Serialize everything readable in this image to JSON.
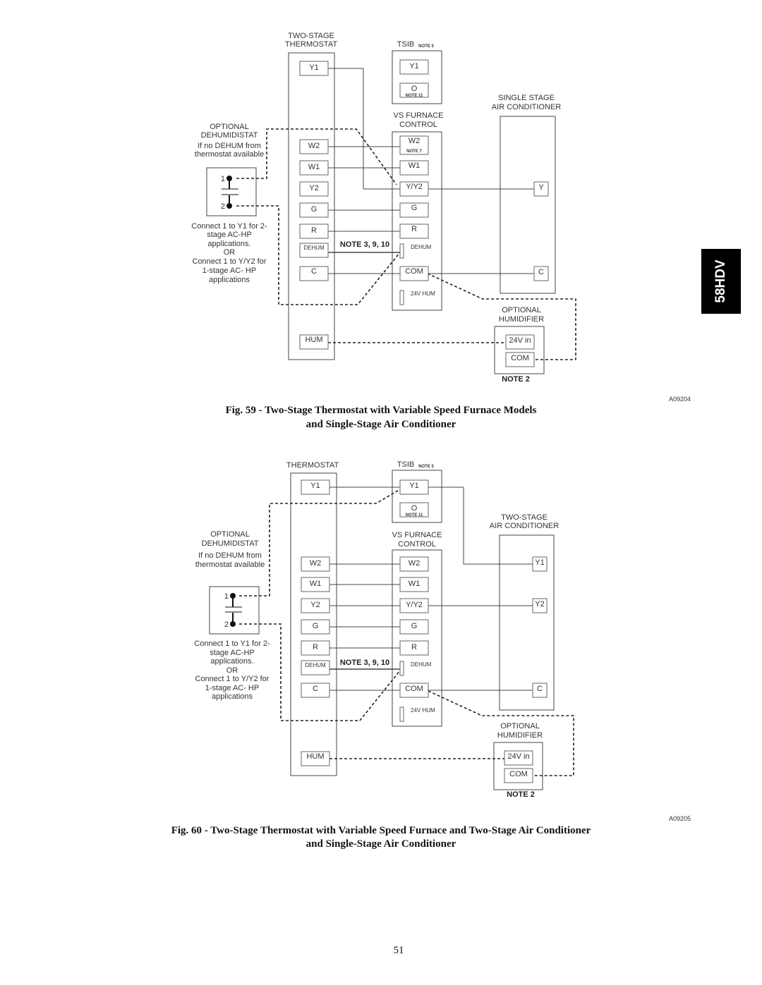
{
  "side_tab": "58HDV",
  "page_number": "51",
  "fig59": {
    "thermostat_title_1": "TWO-STAGE",
    "thermostat_title_2": "THERMOSTAT",
    "tsib_title": "TSIB",
    "tsib_note": "NOTE 5",
    "tsib_terminals": {
      "y1": "Y1",
      "o": "O",
      "o_note": "NOTE 11"
    },
    "furnace_title_1": "VS FURNACE",
    "furnace_title_2": "CONTROL",
    "ac_title_1": "SINGLE STAGE",
    "ac_title_2": "AIR CONDITIONER",
    "dehum_title_1": "OPTIONAL",
    "dehum_title_2": "DEHUMIDISTAT",
    "dehum_sub_1": "If no DEHUM from",
    "dehum_sub_2": "thermostat available",
    "dehum_pin_1": "1",
    "dehum_pin_2": "2",
    "connect_notes": [
      "Connect 1 to Y1 for 2-",
      "stage AC-HP",
      "applications.",
      "OR",
      "Connect 1 to Y/Y2 for",
      "1-stage AC- HP",
      "applications"
    ],
    "thermostat_terminals": [
      "Y1",
      "W2",
      "W1",
      "Y2",
      "G",
      "R",
      "DEHUM",
      "C",
      "HUM"
    ],
    "furnace_terminals": {
      "w2": "W2",
      "w2_note": "NOTE 7",
      "w1": "W1",
      "yy2": "Y/Y2",
      "g": "G",
      "r": "R",
      "dehum": "DEHUM",
      "com": "COM",
      "hum": "24V HUM"
    },
    "ac_terminals": [
      "Y",
      "C"
    ],
    "dehum_note": "NOTE 3, 9, 10",
    "humidifier_title_1": "OPTIONAL",
    "humidifier_title_2": "HUMIDIFIER",
    "humidifier_terminals": [
      "24V in",
      "COM"
    ],
    "humidifier_note": "NOTE 2",
    "code": "A09204",
    "caption_1": "Fig. 59 - Two-Stage Thermostat with Variable Speed Furnace  Models",
    "caption_2": "and Single-Stage Air Conditioner"
  },
  "fig60": {
    "thermostat_title": "THERMOSTAT",
    "tsib_title": "TSIB",
    "tsib_note": "NOTE 5",
    "tsib_terminals": {
      "y1": "Y1",
      "o": "O",
      "o_note": "NOTE 11"
    },
    "furnace_title_1": "VS FURNACE",
    "furnace_title_2": "CONTROL",
    "ac_title_1": "TWO-STAGE",
    "ac_title_2": "AIR CONDITIONER",
    "dehum_title_1": "OPTIONAL",
    "dehum_title_2": "DEHUMIDISTAT",
    "dehum_sub_1": "If no DEHUM from",
    "dehum_sub_2": "thermostat available",
    "dehum_pin_1": "1",
    "dehum_pin_2": "2",
    "connect_notes": [
      "Connect 1 to Y1 for 2-",
      "stage AC-HP",
      "applications.",
      "OR",
      "Connect 1 to Y/Y2 for",
      "1-stage AC- HP",
      "applications"
    ],
    "thermostat_terminals": [
      "Y1",
      "W2",
      "W1",
      "Y2",
      "G",
      "R",
      "DEHUM",
      "C",
      "HUM"
    ],
    "furnace_terminals": {
      "w2": "W2",
      "w1": "W1",
      "yy2": "Y/Y2",
      "g": "G",
      "r": "R",
      "dehum": "DEHUM",
      "com": "COM",
      "hum": "24V HUM"
    },
    "ac_terminals": [
      "Y1",
      "Y2",
      "C"
    ],
    "dehum_note": "NOTE 3, 9, 10",
    "humidifier_title_1": "OPTIONAL",
    "humidifier_title_2": "HUMIDIFIER",
    "humidifier_terminals": [
      "24V in",
      "COM"
    ],
    "humidifier_note": "NOTE 2",
    "code": "A09205",
    "caption_1": "Fig. 60 - Two-Stage Thermostat with Variable Speed Furnace and Two-Stage Air Conditioner",
    "caption_2": "and Single-Stage Air Conditioner"
  }
}
